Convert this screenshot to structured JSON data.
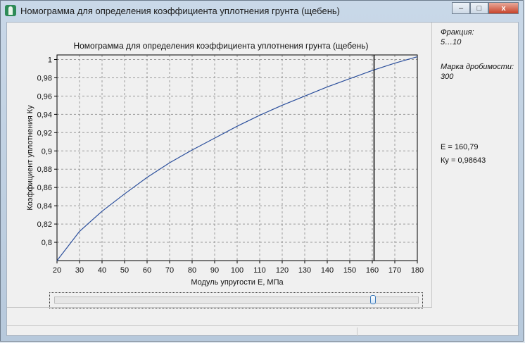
{
  "window": {
    "title": "Номограмма для определения коэффициента уплотнения грунта (щебень)",
    "minimize_glyph": "–",
    "maximize_glyph": "□",
    "close_glyph": "x"
  },
  "info": {
    "fraction_label": "Фракция:",
    "fraction_value": "5…10",
    "grade_label": "Марка дробимости:",
    "grade_value": "300",
    "e_readout": "E  = 160,79",
    "ky_readout": "Ку = 0,98643"
  },
  "slider": {
    "value": 160.79,
    "min": 20,
    "max": 180
  },
  "colors": {
    "curve": "#2b4f9c",
    "marker": "#000000",
    "grid": "#9a9a9a"
  },
  "chart_data": {
    "type": "line",
    "title": "Номограмма для определения коэффициента уплотнения грунта (щебень)",
    "xlabel": "Модуль упругости Е, МПа",
    "ylabel": "Коэффициент уплотнения Ку",
    "xlim": [
      20,
      180
    ],
    "ylim": [
      0.78,
      1.005
    ],
    "x_ticks": [
      20,
      30,
      40,
      50,
      60,
      70,
      80,
      90,
      100,
      110,
      120,
      130,
      140,
      150,
      160,
      170,
      180
    ],
    "y_ticks": [
      "0,8",
      "0,82",
      "0,84",
      "0,86",
      "0,88",
      "0,9",
      "0,92",
      "0,94",
      "0,96",
      "0,98",
      "1"
    ],
    "y_tick_values": [
      0.8,
      0.82,
      0.84,
      0.86,
      0.88,
      0.9,
      0.92,
      0.94,
      0.96,
      0.98,
      1.0
    ],
    "grid": true,
    "series": [
      {
        "x": [
          20,
          30,
          40,
          50,
          60,
          70,
          80,
          90,
          100,
          110,
          120,
          130,
          140,
          150,
          160,
          170,
          180
        ],
        "y": [
          0.78,
          0.812,
          0.834,
          0.853,
          0.871,
          0.887,
          0.901,
          0.914,
          0.927,
          0.939,
          0.95,
          0.96,
          0.97,
          0.979,
          0.988,
          0.996,
          1.003
        ]
      }
    ],
    "marker_x": 160.79
  }
}
